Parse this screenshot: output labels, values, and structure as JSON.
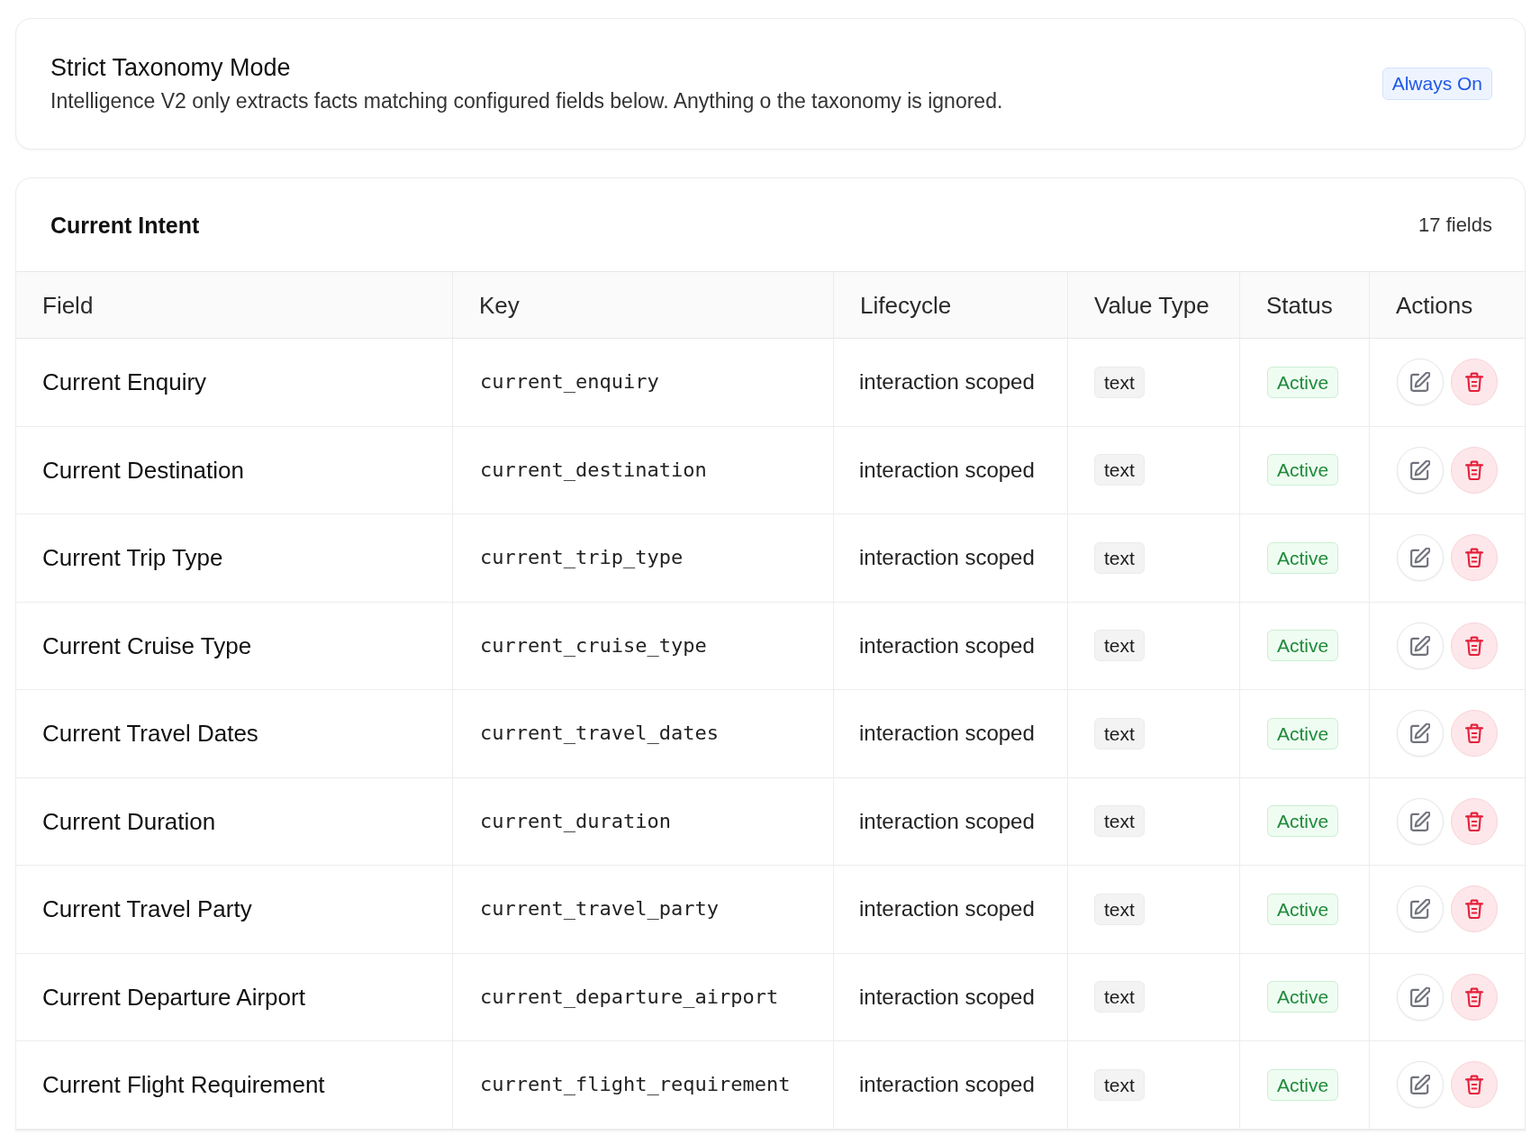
{
  "mode_card": {
    "title": "Strict Taxonomy Mode",
    "description": "Intelligence V2 only extracts facts matching configured fields below. Anything o the taxonomy is ignored.",
    "badge": "Always On"
  },
  "section": {
    "title": "Current Intent",
    "count": "17 fields"
  },
  "table": {
    "columns": [
      "Field",
      "Key",
      "Lifecycle",
      "Value Type",
      "Status",
      "Actions"
    ],
    "rows": [
      {
        "field": "Current Enquiry",
        "key": "current_enquiry",
        "lifecycle": "interaction scoped",
        "value_type": "text",
        "status": "Active"
      },
      {
        "field": "Current Destination",
        "key": "current_destination",
        "lifecycle": "interaction scoped",
        "value_type": "text",
        "status": "Active"
      },
      {
        "field": "Current Trip Type",
        "key": "current_trip_type",
        "lifecycle": "interaction scoped",
        "value_type": "text",
        "status": "Active"
      },
      {
        "field": "Current Cruise Type",
        "key": "current_cruise_type",
        "lifecycle": "interaction scoped",
        "value_type": "text",
        "status": "Active"
      },
      {
        "field": "Current Travel Dates",
        "key": "current_travel_dates",
        "lifecycle": "interaction scoped",
        "value_type": "text",
        "status": "Active"
      },
      {
        "field": "Current Duration",
        "key": "current_duration",
        "lifecycle": "interaction scoped",
        "value_type": "text",
        "status": "Active"
      },
      {
        "field": "Current Travel Party",
        "key": "current_travel_party",
        "lifecycle": "interaction scoped",
        "value_type": "text",
        "status": "Active"
      },
      {
        "field": "Current Departure Airport",
        "key": "current_departure_airport",
        "lifecycle": "interaction scoped",
        "value_type": "text",
        "status": "Active"
      },
      {
        "field": "Current Flight Requirement",
        "key": "current_flight_requirement",
        "lifecycle": "interaction scoped",
        "value_type": "text",
        "status": "Active"
      }
    ]
  }
}
